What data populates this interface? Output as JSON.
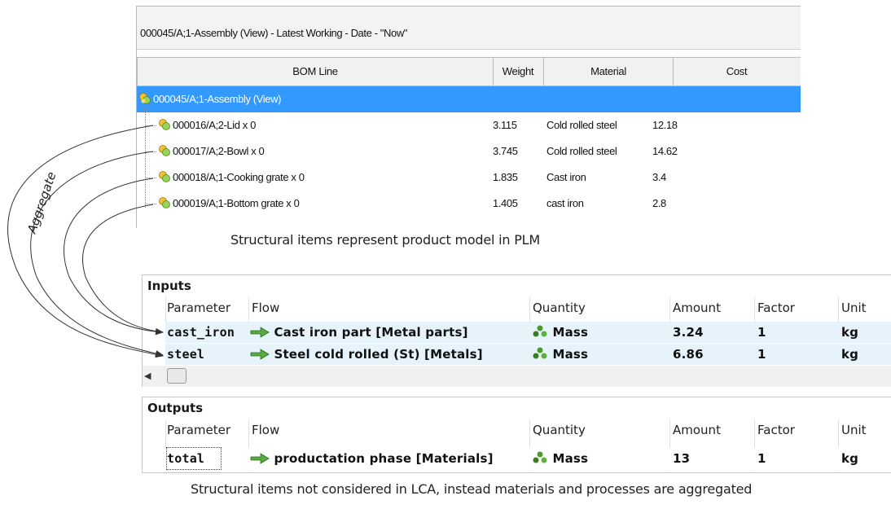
{
  "plm": {
    "title": "000045/A;1-Assembly (View) - Latest Working - Date - \"Now\"",
    "columns": [
      "BOM Line",
      "Weight",
      "Material",
      "Cost"
    ],
    "root": {
      "label": "000045/A;1-Assembly (View)"
    },
    "rows": [
      {
        "bom": "000016/A;2-Lid x 0",
        "weight": "3.115",
        "material": "Cold rolled steel",
        "cost": "12.18"
      },
      {
        "bom": "000017/A;2-Bowl x 0",
        "weight": "3.745",
        "material": "Cold rolled steel",
        "cost": "14.62"
      },
      {
        "bom": "000018/A;1-Cooking grate x 0",
        "weight": "1.835",
        "material": "Cast iron",
        "cost": "3.4"
      },
      {
        "bom": "000019/A;1-Bottom grate x 0",
        "weight": "1.405",
        "material": "cast iron",
        "cost": "2.8"
      }
    ],
    "caption": "Structural items represent product model in PLM"
  },
  "annotation": {
    "aggregate": "Aggregate"
  },
  "inputs": {
    "title": "Inputs",
    "columns": [
      "Parameter",
      "Flow",
      "Quantity",
      "Amount",
      "Factor",
      "Unit"
    ],
    "rows": [
      {
        "parameter": "cast_iron",
        "flow": "Cast iron part [Metal parts]",
        "quantity": "Mass",
        "amount": "3.24",
        "factor": "1",
        "unit": "kg"
      },
      {
        "parameter": "steel",
        "flow": "Steel cold rolled (St) [Metals]",
        "quantity": "Mass",
        "amount": "6.86",
        "factor": "1",
        "unit": "kg"
      }
    ]
  },
  "outputs": {
    "title": "Outputs",
    "columns": [
      "Parameter",
      "Flow",
      "Quantity",
      "Amount",
      "Factor",
      "Unit"
    ],
    "rows": [
      {
        "parameter": "total",
        "flow": "productation phase [Materials]",
        "quantity": "Mass",
        "amount": "13",
        "factor": "1",
        "unit": "kg"
      }
    ]
  },
  "caption_bottom": "Structural items not considered in LCA, instead materials and processes are aggregated",
  "icons": {
    "tree_node": "assembly-icon",
    "flow": "flow-arrow-icon",
    "quantity": "mass-icon"
  },
  "colors": {
    "selection": "#3399ff",
    "row_highlight": "#e6f3fb",
    "flow_arrow": "#4a9e3a"
  }
}
